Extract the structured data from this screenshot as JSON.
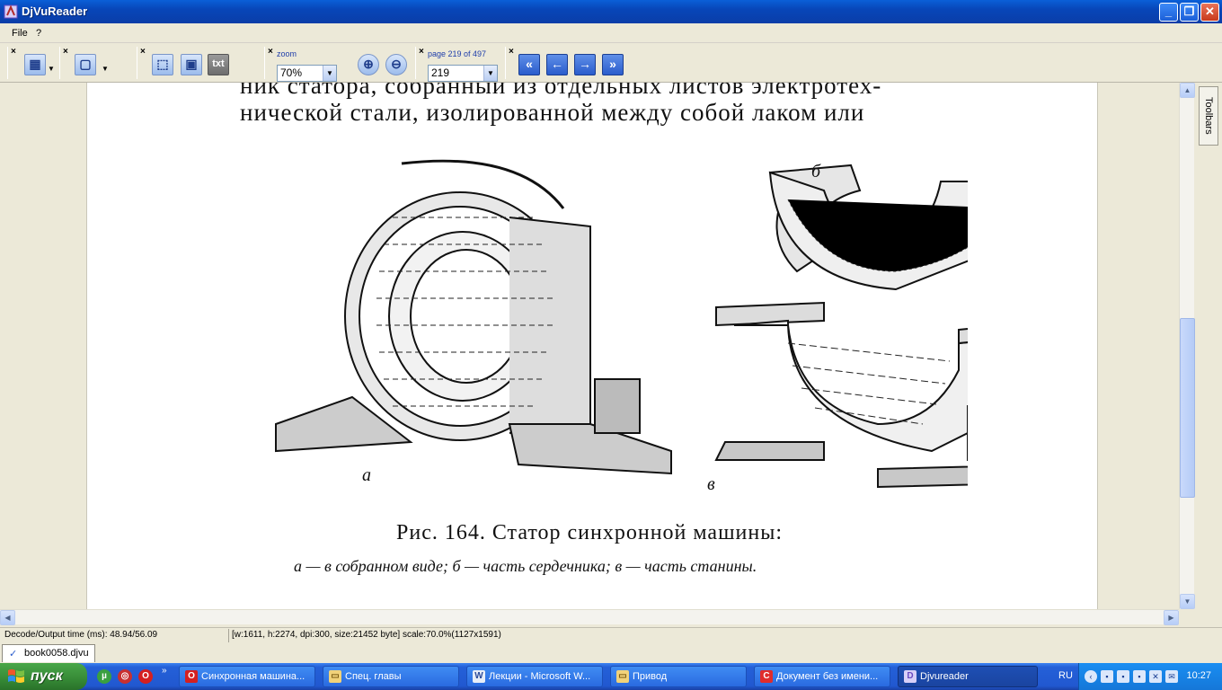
{
  "window": {
    "title": "DjVuReader"
  },
  "menu": {
    "file": "File",
    "help": "?"
  },
  "toolbar": {
    "zoom_label": "zoom",
    "zoom_value": "70%",
    "page_label": "page 219 of 497",
    "page_value": "219",
    "txt_label": "txt"
  },
  "toolbars_tab": "Toolbars",
  "document": {
    "line1": "ник статора, собранный из отдельных листов электротех-",
    "line2": "нической стали, изолированной между собой лаком или",
    "label_a": "а",
    "label_b": "б",
    "label_v": "в",
    "caption": "Рис. 164. Статор синхронной машины:",
    "subcaption": "а — в собранном виде; б — часть сердечника; в — часть станины."
  },
  "status": {
    "decode": "Decode/Output time (ms): 48.94/56.09",
    "info": "[w:1611, h:2274, dpi:300, size:21452 byte] scale:70.0%(1127x1591)"
  },
  "doc_tab": "book0058.djvu",
  "taskbar": {
    "start": "пуск",
    "tasks": [
      "Синхронная машина...",
      "Спец. главы",
      "Лекции - Microsoft W...",
      "Привод",
      "Документ без имени...",
      "Djvureader"
    ],
    "lang": "RU",
    "clock": "10:27"
  }
}
